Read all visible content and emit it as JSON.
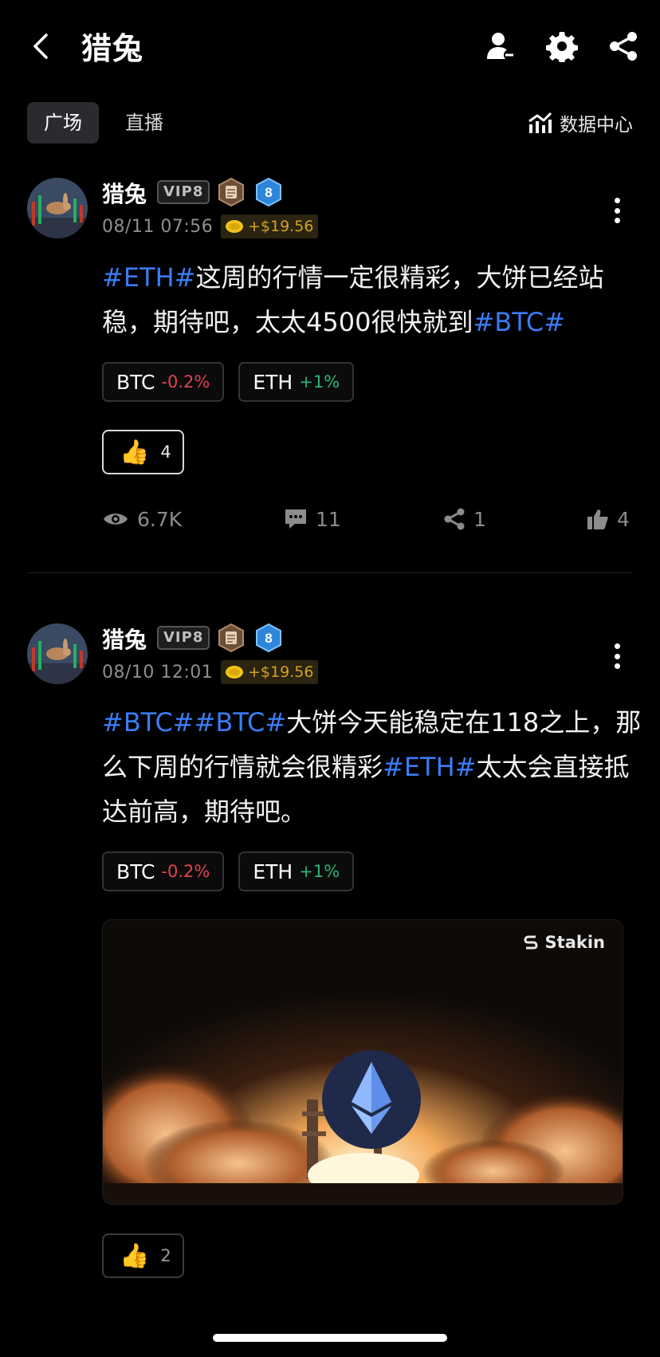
{
  "header": {
    "title": "猎兔"
  },
  "tabs": [
    {
      "label": "广场"
    },
    {
      "label": "直播"
    }
  ],
  "data_center": {
    "label": "数据中心"
  },
  "posts": [
    {
      "author": "猎兔",
      "vip": "VIP8",
      "level": "8",
      "date": "08/11 07:56",
      "reward": "+$19.56",
      "content": [
        {
          "text": "#ETH#",
          "tag": true
        },
        {
          "text": "这周的行情一定很精彩，大饼已经站稳，期待吧，太太4500很快就到",
          "tag": false
        },
        {
          "text": "#BTC#",
          "tag": true
        }
      ],
      "chips": [
        {
          "symbol": "BTC",
          "change": "-0.2%",
          "direction": "down"
        },
        {
          "symbol": "ETH",
          "change": "+1%",
          "direction": "up"
        }
      ],
      "reaction": {
        "emoji": "👍",
        "count": "4"
      },
      "stats": {
        "views": "6.7K",
        "comments": "11",
        "shares": "1",
        "likes": "4"
      }
    },
    {
      "author": "猎兔",
      "vip": "VIP8",
      "level": "8",
      "date": "08/10 12:01",
      "reward": "+$19.56",
      "content": [
        {
          "text": "#BTC##BTC#",
          "tag": true
        },
        {
          "text": "大饼今天能稳定在118之上，那么下周的行情就会很精彩",
          "tag": false
        },
        {
          "text": "#ETH#",
          "tag": true
        },
        {
          "text": "太太会直接抵达前高，期待吧。",
          "tag": false
        }
      ],
      "chips": [
        {
          "symbol": "BTC",
          "change": "-0.2%",
          "direction": "down"
        },
        {
          "symbol": "ETH",
          "change": "+1%",
          "direction": "up"
        }
      ],
      "media": {
        "brand": "Stakin"
      },
      "reaction": {
        "emoji": "👍",
        "count": "2"
      }
    }
  ],
  "colors": {
    "tag": "#3b7cf6",
    "down": "#e0434f",
    "up": "#2bb673",
    "reward": "#d6a21e"
  }
}
